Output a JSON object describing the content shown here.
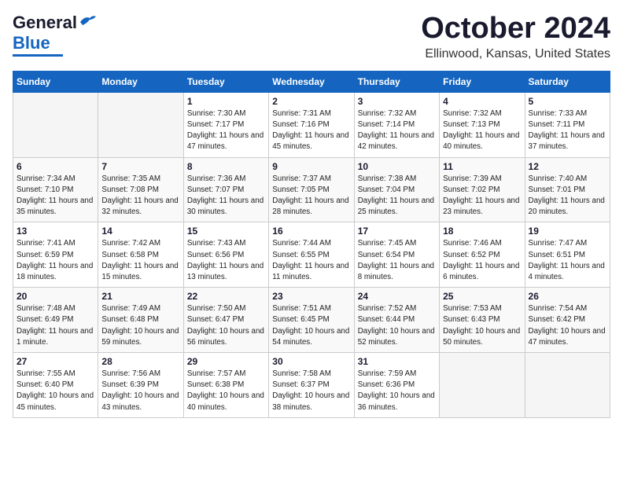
{
  "header": {
    "logo_line1": "General",
    "logo_line2": "Blue",
    "month": "October 2024",
    "location": "Ellinwood, Kansas, United States"
  },
  "days_of_week": [
    "Sunday",
    "Monday",
    "Tuesday",
    "Wednesday",
    "Thursday",
    "Friday",
    "Saturday"
  ],
  "weeks": [
    [
      {
        "day": "",
        "sunrise": "",
        "sunset": "",
        "daylight": ""
      },
      {
        "day": "",
        "sunrise": "",
        "sunset": "",
        "daylight": ""
      },
      {
        "day": "1",
        "sunrise": "Sunrise: 7:30 AM",
        "sunset": "Sunset: 7:17 PM",
        "daylight": "Daylight: 11 hours and 47 minutes."
      },
      {
        "day": "2",
        "sunrise": "Sunrise: 7:31 AM",
        "sunset": "Sunset: 7:16 PM",
        "daylight": "Daylight: 11 hours and 45 minutes."
      },
      {
        "day": "3",
        "sunrise": "Sunrise: 7:32 AM",
        "sunset": "Sunset: 7:14 PM",
        "daylight": "Daylight: 11 hours and 42 minutes."
      },
      {
        "day": "4",
        "sunrise": "Sunrise: 7:32 AM",
        "sunset": "Sunset: 7:13 PM",
        "daylight": "Daylight: 11 hours and 40 minutes."
      },
      {
        "day": "5",
        "sunrise": "Sunrise: 7:33 AM",
        "sunset": "Sunset: 7:11 PM",
        "daylight": "Daylight: 11 hours and 37 minutes."
      }
    ],
    [
      {
        "day": "6",
        "sunrise": "Sunrise: 7:34 AM",
        "sunset": "Sunset: 7:10 PM",
        "daylight": "Daylight: 11 hours and 35 minutes."
      },
      {
        "day": "7",
        "sunrise": "Sunrise: 7:35 AM",
        "sunset": "Sunset: 7:08 PM",
        "daylight": "Daylight: 11 hours and 32 minutes."
      },
      {
        "day": "8",
        "sunrise": "Sunrise: 7:36 AM",
        "sunset": "Sunset: 7:07 PM",
        "daylight": "Daylight: 11 hours and 30 minutes."
      },
      {
        "day": "9",
        "sunrise": "Sunrise: 7:37 AM",
        "sunset": "Sunset: 7:05 PM",
        "daylight": "Daylight: 11 hours and 28 minutes."
      },
      {
        "day": "10",
        "sunrise": "Sunrise: 7:38 AM",
        "sunset": "Sunset: 7:04 PM",
        "daylight": "Daylight: 11 hours and 25 minutes."
      },
      {
        "day": "11",
        "sunrise": "Sunrise: 7:39 AM",
        "sunset": "Sunset: 7:02 PM",
        "daylight": "Daylight: 11 hours and 23 minutes."
      },
      {
        "day": "12",
        "sunrise": "Sunrise: 7:40 AM",
        "sunset": "Sunset: 7:01 PM",
        "daylight": "Daylight: 11 hours and 20 minutes."
      }
    ],
    [
      {
        "day": "13",
        "sunrise": "Sunrise: 7:41 AM",
        "sunset": "Sunset: 6:59 PM",
        "daylight": "Daylight: 11 hours and 18 minutes."
      },
      {
        "day": "14",
        "sunrise": "Sunrise: 7:42 AM",
        "sunset": "Sunset: 6:58 PM",
        "daylight": "Daylight: 11 hours and 15 minutes."
      },
      {
        "day": "15",
        "sunrise": "Sunrise: 7:43 AM",
        "sunset": "Sunset: 6:56 PM",
        "daylight": "Daylight: 11 hours and 13 minutes."
      },
      {
        "day": "16",
        "sunrise": "Sunrise: 7:44 AM",
        "sunset": "Sunset: 6:55 PM",
        "daylight": "Daylight: 11 hours and 11 minutes."
      },
      {
        "day": "17",
        "sunrise": "Sunrise: 7:45 AM",
        "sunset": "Sunset: 6:54 PM",
        "daylight": "Daylight: 11 hours and 8 minutes."
      },
      {
        "day": "18",
        "sunrise": "Sunrise: 7:46 AM",
        "sunset": "Sunset: 6:52 PM",
        "daylight": "Daylight: 11 hours and 6 minutes."
      },
      {
        "day": "19",
        "sunrise": "Sunrise: 7:47 AM",
        "sunset": "Sunset: 6:51 PM",
        "daylight": "Daylight: 11 hours and 4 minutes."
      }
    ],
    [
      {
        "day": "20",
        "sunrise": "Sunrise: 7:48 AM",
        "sunset": "Sunset: 6:49 PM",
        "daylight": "Daylight: 11 hours and 1 minute."
      },
      {
        "day": "21",
        "sunrise": "Sunrise: 7:49 AM",
        "sunset": "Sunset: 6:48 PM",
        "daylight": "Daylight: 10 hours and 59 minutes."
      },
      {
        "day": "22",
        "sunrise": "Sunrise: 7:50 AM",
        "sunset": "Sunset: 6:47 PM",
        "daylight": "Daylight: 10 hours and 56 minutes."
      },
      {
        "day": "23",
        "sunrise": "Sunrise: 7:51 AM",
        "sunset": "Sunset: 6:45 PM",
        "daylight": "Daylight: 10 hours and 54 minutes."
      },
      {
        "day": "24",
        "sunrise": "Sunrise: 7:52 AM",
        "sunset": "Sunset: 6:44 PM",
        "daylight": "Daylight: 10 hours and 52 minutes."
      },
      {
        "day": "25",
        "sunrise": "Sunrise: 7:53 AM",
        "sunset": "Sunset: 6:43 PM",
        "daylight": "Daylight: 10 hours and 50 minutes."
      },
      {
        "day": "26",
        "sunrise": "Sunrise: 7:54 AM",
        "sunset": "Sunset: 6:42 PM",
        "daylight": "Daylight: 10 hours and 47 minutes."
      }
    ],
    [
      {
        "day": "27",
        "sunrise": "Sunrise: 7:55 AM",
        "sunset": "Sunset: 6:40 PM",
        "daylight": "Daylight: 10 hours and 45 minutes."
      },
      {
        "day": "28",
        "sunrise": "Sunrise: 7:56 AM",
        "sunset": "Sunset: 6:39 PM",
        "daylight": "Daylight: 10 hours and 43 minutes."
      },
      {
        "day": "29",
        "sunrise": "Sunrise: 7:57 AM",
        "sunset": "Sunset: 6:38 PM",
        "daylight": "Daylight: 10 hours and 40 minutes."
      },
      {
        "day": "30",
        "sunrise": "Sunrise: 7:58 AM",
        "sunset": "Sunset: 6:37 PM",
        "daylight": "Daylight: 10 hours and 38 minutes."
      },
      {
        "day": "31",
        "sunrise": "Sunrise: 7:59 AM",
        "sunset": "Sunset: 6:36 PM",
        "daylight": "Daylight: 10 hours and 36 minutes."
      },
      {
        "day": "",
        "sunrise": "",
        "sunset": "",
        "daylight": ""
      },
      {
        "day": "",
        "sunrise": "",
        "sunset": "",
        "daylight": ""
      }
    ]
  ]
}
